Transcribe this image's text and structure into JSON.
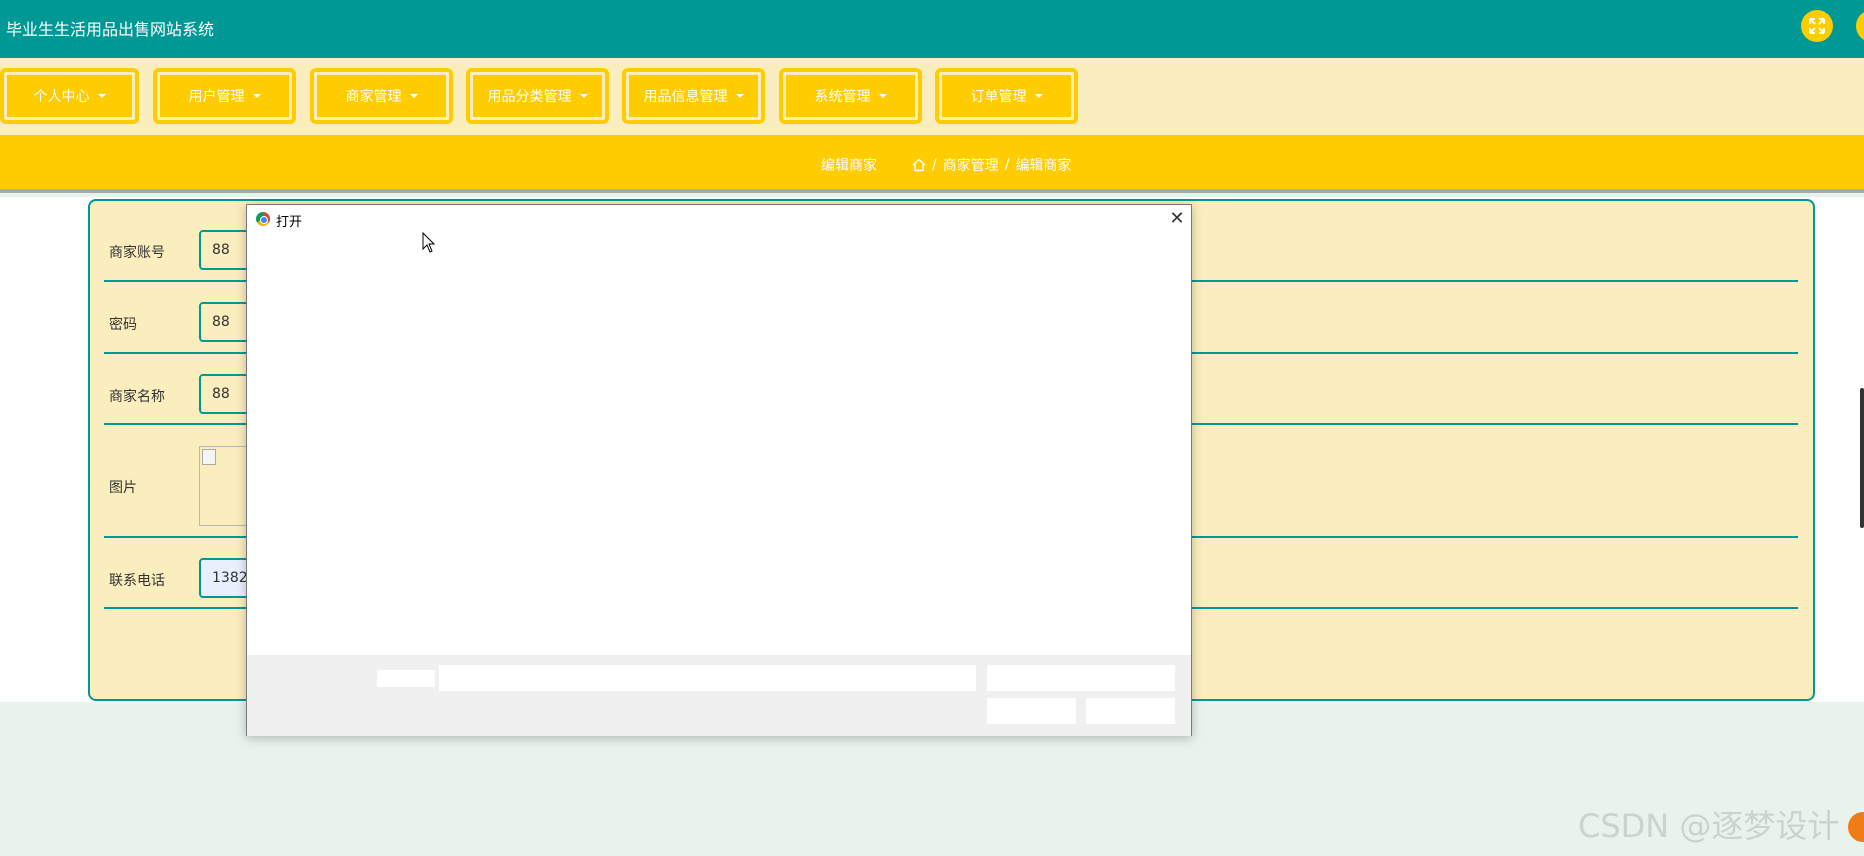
{
  "app": {
    "title": "毕业生生活用品出售网站系统"
  },
  "icons": {
    "fullscreen": "fullscreen-icon",
    "home": "home-icon",
    "close": "close-icon",
    "browser": "chrome-icon"
  },
  "colors": {
    "primary": "#009895",
    "accent": "#ffcc00",
    "panel": "#fbeebe"
  },
  "nav": {
    "items": [
      {
        "label": "个人中心"
      },
      {
        "label": "用户管理"
      },
      {
        "label": "商家管理"
      },
      {
        "label": "用品分类管理"
      },
      {
        "label": "用品信息管理"
      },
      {
        "label": "系统管理"
      },
      {
        "label": "订单管理"
      }
    ]
  },
  "breadcrumb": {
    "title": "编辑商家",
    "path1": "商家管理",
    "path2": "编辑商家",
    "sep": "/"
  },
  "form": {
    "account_label": "商家账号",
    "account_value": "88",
    "password_label": "密码",
    "password_value": "88",
    "name_label": "商家名称",
    "name_value": "88",
    "image_label": "图片",
    "phone_label": "联系电话",
    "phone_value": "1382"
  },
  "dialog": {
    "title": "打开",
    "close": "✕"
  },
  "watermark": "CSDN @逐梦设计"
}
